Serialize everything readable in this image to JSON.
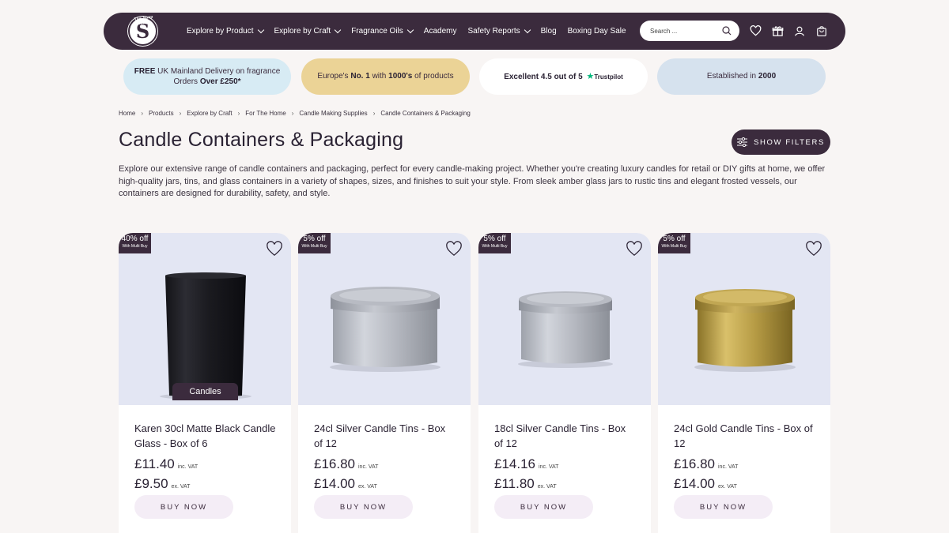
{
  "brand": {
    "logo_letter": "S",
    "logo_arc_text": "The Soap Kitchen"
  },
  "nav": {
    "items": [
      {
        "label": "Explore by Product",
        "dropdown": true
      },
      {
        "label": "Explore by Craft",
        "dropdown": true
      },
      {
        "label": "Fragrance Oils",
        "dropdown": true
      },
      {
        "label": "Academy",
        "dropdown": false
      },
      {
        "label": "Safety Reports",
        "dropdown": true
      },
      {
        "label": "Blog",
        "dropdown": false
      },
      {
        "label": "Boxing Day Sale",
        "dropdown": false
      }
    ],
    "search_placeholder": "Search ...",
    "icons": [
      "heart-icon",
      "gift-icon",
      "user-icon",
      "bag-icon"
    ]
  },
  "promos": {
    "delivery": {
      "pre": "FREE",
      "mid": " UK Mainland Delivery on fragrance Orders ",
      "bold": "Over £250*"
    },
    "europe": {
      "pre": "Europe's ",
      "b1": "No. 1",
      "mid": " with ",
      "b2": "1000's",
      "post": " of products"
    },
    "trustpilot": {
      "text": "Excellent 4.5 out of 5",
      "brand": "Trustpilot"
    },
    "established": {
      "pre": "Established in ",
      "bold": "2000"
    }
  },
  "breadcrumb": [
    "Home",
    "Products",
    "Explore by Craft",
    "For The Home",
    "Candle Making Supplies",
    "Candle Containers & Packaging"
  ],
  "page": {
    "title": "Candle Containers & Packaging",
    "filters_label": "SHOW FILTERS",
    "intro": "Explore our extensive range of candle containers and packaging, perfect for every candle-making project. Whether you're creating luxury candles for retail or DIY gifts at home, we offer high-quality jars, tins, and glass containers in a variety of shapes, sizes, and finishes to suit your style. From sleek amber glass jars to rustic tins and elegant frosted vessels, our containers are designed for durability, safety, and style."
  },
  "products": [
    {
      "name": "Karen 30cl Matte Black Candle Glass - Box of 6",
      "badge": "40% off",
      "badge_sub": "With Multi Buy",
      "tag": "Candles",
      "price_inc": "£11.40",
      "price_ex": "£9.50",
      "inc_label": "inc. VAT",
      "ex_label": "ex. VAT",
      "buy_label": "BUY NOW"
    },
    {
      "name": "24cl Silver Candle Tins - Box of 12",
      "badge": "5% off",
      "badge_sub": "With Multi Buy",
      "price_inc": "£16.80",
      "price_ex": "£14.00",
      "inc_label": "inc. VAT",
      "ex_label": "ex. VAT",
      "buy_label": "BUY NOW"
    },
    {
      "name": "18cl Silver Candle Tins - Box of 12",
      "badge": "5% off",
      "badge_sub": "With Multi Buy",
      "price_inc": "£14.16",
      "price_ex": "£11.80",
      "inc_label": "inc. VAT",
      "ex_label": "ex. VAT",
      "buy_label": "BUY NOW"
    },
    {
      "name": "24cl Gold Candle Tins - Box of 12",
      "badge": "5% off",
      "badge_sub": "With Multi Buy",
      "price_inc": "£16.80",
      "price_ex": "£14.00",
      "inc_label": "inc. VAT",
      "ex_label": "ex. VAT",
      "buy_label": "BUY NOW"
    }
  ],
  "colors": {
    "brand": "#3b2b3d",
    "background": "#f8f5f4",
    "product_bg": "#e3e6f3",
    "trustpilot_green": "#00b67a",
    "gold": "#ebd396",
    "sky": "#d7ebf4"
  }
}
